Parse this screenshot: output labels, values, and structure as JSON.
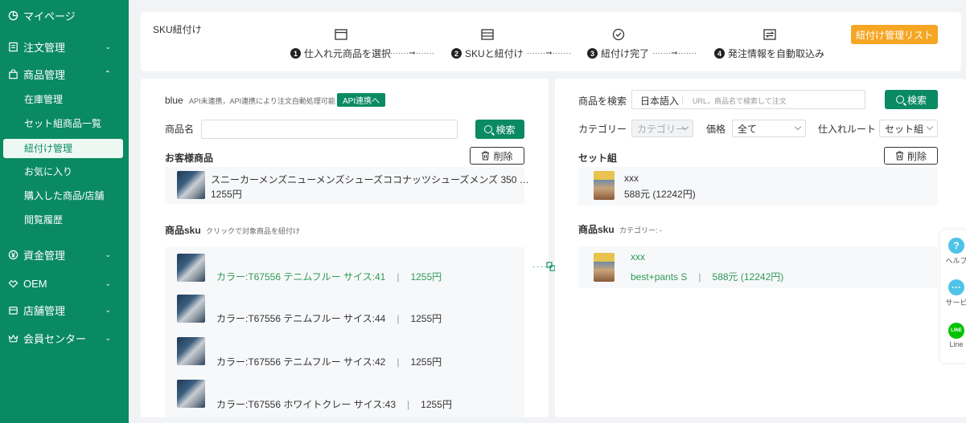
{
  "sidebar": {
    "mypage": "マイページ",
    "orders": "注文管理",
    "products": "商品管理",
    "product_subitems": [
      "在庫管理",
      "セット組商品一覧",
      "紐付け管理",
      "お気に入り",
      "購入した商品/店舗",
      "閲覧履歴"
    ],
    "funds": "資金管理",
    "oem": "OEM",
    "stores": "店舗管理",
    "members": "会員センター"
  },
  "header": {
    "title": "SKU紐付け",
    "steps": [
      {
        "num": "1",
        "label": "仕入れ元商品を選択"
      },
      {
        "num": "2",
        "label": "SKUと紐付け"
      },
      {
        "num": "3",
        "label": "紐付け完了"
      },
      {
        "num": "4",
        "label": "発注情報を自動取込み"
      }
    ],
    "dots": "·······➞·······",
    "list_button": "紐付け管理リスト"
  },
  "left": {
    "store_name": "blue",
    "api_note": "API未連携，API連携により注文自動処理可能",
    "api_button": "API連携へ",
    "product_name_label": "商品名",
    "search_button": "検索",
    "customer_product_title": "お客様商品",
    "delete_button": "削除",
    "product": {
      "name": "スニーカーメンズニューメンズシューズココナッツシューズメンズ 350 …",
      "price": "1255円"
    },
    "sku_title": "商品sku",
    "sku_hint": "クリックで対象商品を紐付け",
    "skus": [
      {
        "text": "カラー:T67556 テニムフルー サイス:41",
        "sep": "|",
        "price": "1255円"
      },
      {
        "text": "カラー:T67556 テニムフルー サイス:44",
        "sep": "|",
        "price": "1255円"
      },
      {
        "text": "カラー:T67556 テニムフルー サイス:42",
        "sep": "|",
        "price": "1255円"
      },
      {
        "text": "カラー:T67556 ホワイトクレー サイス:43",
        "sep": "|",
        "price": "1255円"
      }
    ]
  },
  "right": {
    "search_label": "商品を検索",
    "lang_value": "日本語入",
    "search_placeholder": "URL，商品名で検索して注文",
    "search_button": "検索",
    "category_label": "カテゴリー",
    "category_value": "カテゴリー",
    "price_label": "価格",
    "price_value": "全て",
    "route_label": "仕入れルート",
    "route_value": "セット組",
    "set_title": "セット組",
    "delete_button": "削除",
    "set_item": {
      "name": "xxx",
      "price": "588元 (12242円)"
    },
    "sku_title": "商品sku",
    "sku_category": "カテゴリー: -",
    "sku_item": {
      "name": "xxx",
      "variant": "best+pants S",
      "sep": "|",
      "price": "588元 (12242円)"
    }
  },
  "floatbar": {
    "help": "ヘルプ",
    "service": "サービ",
    "line_icon_text": "LINE",
    "line": "Line"
  }
}
